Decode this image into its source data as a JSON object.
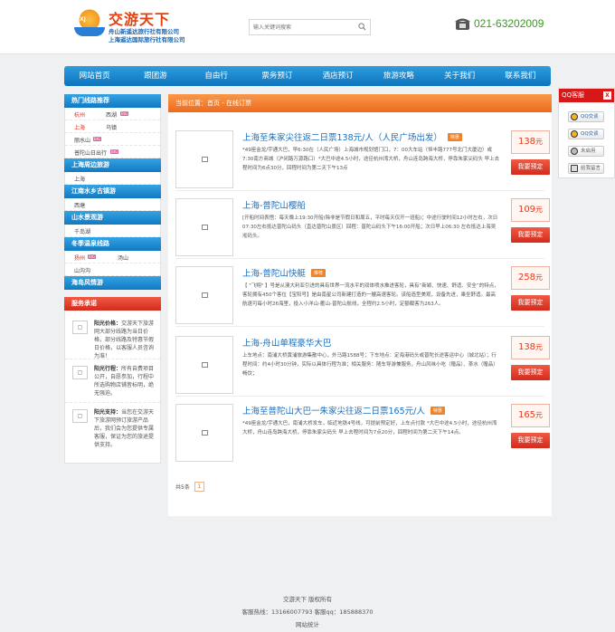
{
  "header": {
    "logo_badge": "XJ",
    "logo_name": "交游天下",
    "company_1": "舟山新遥达旅行社有限公司",
    "company_2": "上海遥达国际旅行社有限公司",
    "search_placeholder": "输入关键词搜索",
    "phone": "021-63202009"
  },
  "nav": [
    "网站首页",
    "跟团游",
    "自由行",
    "票务预订",
    "酒店预订",
    "旅游攻略",
    "关于我们",
    "联系我们"
  ],
  "sidebar": {
    "hot_title": "热门线路推荐",
    "hot_rows": [
      {
        "a": "杭州",
        "b": "西湖",
        "badge": "BIG"
      },
      {
        "a": "上海",
        "b": "乌镇"
      },
      {
        "a": "丽水山",
        "badge": "BIG"
      },
      {
        "a": "普陀山日出行",
        "badge": "BIG"
      }
    ],
    "sec_shanghai": "上海周边旅游",
    "shanghai_row": "上海",
    "sec_jiangnan": "江南水乡古镇游",
    "jiangnan_row": "西塘",
    "sec_mountain": "山水景观游",
    "mountain_row": "千岛湖",
    "sec_winter": "冬季温泉线路",
    "winter_rows": [
      {
        "a": "扬州",
        "badge": "BIG",
        "b": "汤山"
      },
      {
        "a": "山沟沟"
      }
    ],
    "sec_island": "海岛风情游",
    "service_title": "服务承诺",
    "services": [
      {
        "title": "阳光价格：",
        "text": "交游天下旅游网大部分线路为当日价格，部分线路及特惠节假日价格，以客服人员咨询为准！"
      },
      {
        "title": "阳光行程：",
        "text": "所有自费项目公开，自愿参加，行程中所选购物店铺皆标明，绝无强迫。"
      },
      {
        "title": "阳光支持：",
        "text": "当您在交游天下旅游网预订旅游产品后，我们会为您提供专属客服，保证为您的旅途提供支持。"
      }
    ]
  },
  "main": {
    "breadcrumb": "当前位置：首页 - 在线订票",
    "book_label": "我要预定",
    "cards": [
      {
        "title": "上海至朱家尖往返二日票138元/人（人民广场出发）",
        "tag": "特惠",
        "price": "138",
        "unit": "元",
        "desc": "*49座金龙/宇通大巴，早6:30在（人民广场）上海城市规划馆门口，7：00大车站（恒丰路777号北门大厦边）或7:30南方商城（沪闵路万源路口）*大巴中途4.5小时，途径杭州湾大桥，舟山连岛跨海大桥，停靠朱家尖码头 早上去程时间为6点30分，回程时间为第二天下午13点"
      },
      {
        "title": "上海-普陀山樱船",
        "price": "109",
        "unit": "元",
        "desc": "[开船时间表悟：每天晚上19:30开船(除非是节假日和周五，平时每天仅开一班船)；中途行驶时间12小时左右，次日07:30左右抵达普陀山码头（直达普陀山景区）回程：普陀山码头下午16:00开船；次日早上06:30 左右抵达上海吴淞码头。"
      },
      {
        "title": "上海-普陀山快艇",
        "tag": "推荐",
        "price": "258",
        "unit": "元",
        "desc": "【 \"飞翔\" 】号是从澳大利亚引进的具有世界一流水平的双体喷水推进客轮，具有“新颖、快速、舒适、安全”的特点，客轮拥有450个客位【宝阳号】是由南星公司新建打造的一艘高速客轮。该船造型美观，设备先进，乘坐舒适。最高航速可每小时26海里，投入小洋山-衢山-普陀山航线，全程约2.5小时，定额载客为263人。"
      },
      {
        "title": "上海-舟山单程豪华大巴",
        "price": "138",
        "unit": "元",
        "desc": "上车地点：南浦大桥黄浦旅游集散中心，外马路1588号；下车地点：定海港码头或普陀长途客运中心（城北站）；行程时间：约4小时30分钟，实际以具体行程为准；相关服务：随车导游兼服务，舟山风味小吃（赠品）、茶水（赠品）畅饮；"
      },
      {
        "title": "上海至普陀山大巴一朱家尖往返二日票165元/人",
        "tag": "特惠",
        "price": "165",
        "unit": "元",
        "desc": "*49座金龙/宇通大巴，南浦大桥发车，临近地铁4号线，可提前预定好，上车点付款 *大巴中途4.5小时，途径杭州湾大桥，舟山连岛跨海大桥，停靠朱家尖码头 早上去程时间为7点20分，回程时间为第二天下午14点。"
      }
    ],
    "pager_label": "共5条",
    "pager_current": "1"
  },
  "qq_panel": {
    "title": "QQ客服",
    "close": "X",
    "buttons": [
      "QQ交谈",
      "QQ交谈",
      "未启用",
      "给我留言"
    ]
  },
  "footer": {
    "line1": "交游天下 版权所有",
    "line2": "客服热线：13166007793   客服qq：185888370",
    "line3": "网站统计"
  },
  "colors": {
    "nav": "#1a85cf",
    "accent": "#ee6a1e",
    "price": "#e23a1e",
    "link": "#1a6fbd"
  }
}
